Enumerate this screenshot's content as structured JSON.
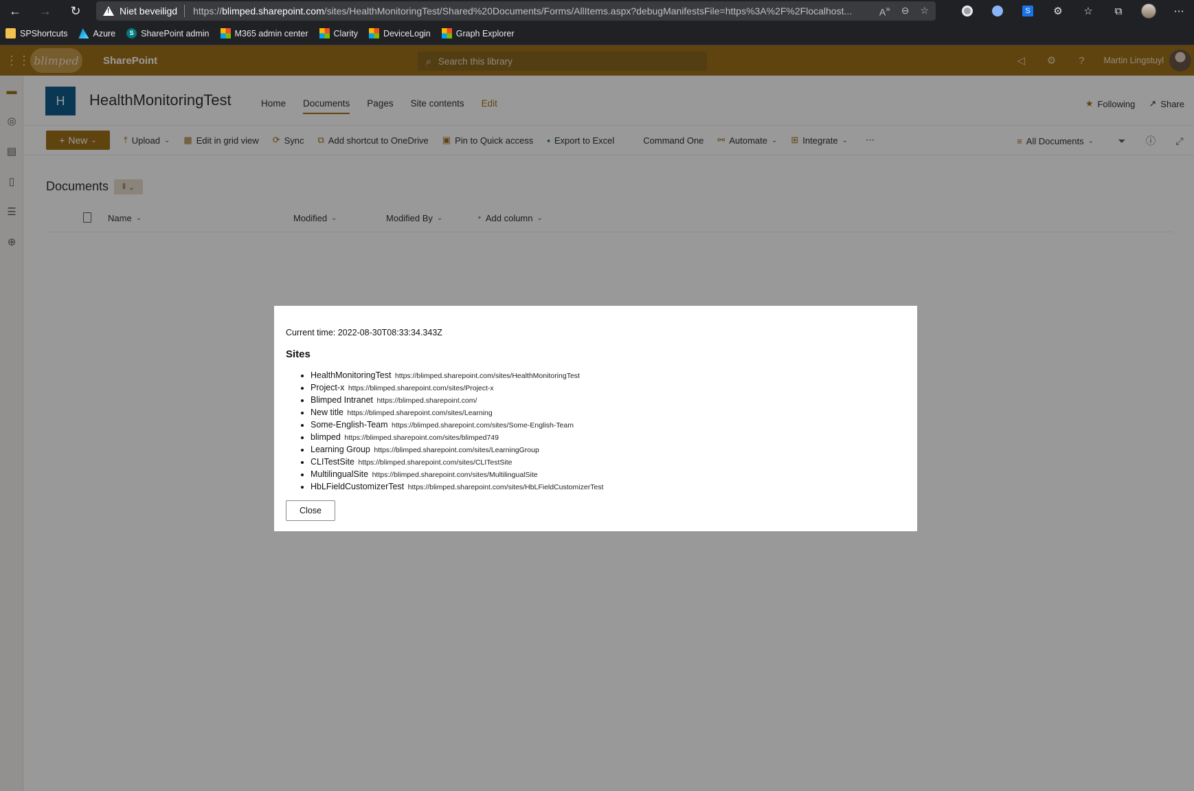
{
  "browser": {
    "security_label": "Niet beveiligd",
    "url_prefix": "https://",
    "url_host": "blimped.sharepoint.com",
    "url_path": "/sites/HealthMonitoringTest/Shared%20Documents/Forms/AllItems.aspx?debugManifestsFile=https%3A%2F%2Flocalhost..."
  },
  "bookmarks": [
    {
      "label": "SPShortcuts",
      "icon": "folder-icon"
    },
    {
      "label": "Azure",
      "icon": "azure-icon"
    },
    {
      "label": "SharePoint admin",
      "icon": "sharepoint-icon"
    },
    {
      "label": "M365 admin center",
      "icon": "microsoft-icon"
    },
    {
      "label": "Clarity",
      "icon": "microsoft-icon"
    },
    {
      "label": "DeviceLogin",
      "icon": "microsoft-icon"
    },
    {
      "label": "Graph Explorer",
      "icon": "microsoft-icon"
    }
  ],
  "suite": {
    "logo_text": "blimped",
    "app_name": "SharePoint",
    "search_placeholder": "Search this library",
    "user_name": "Martin Lingstuyl"
  },
  "site": {
    "logo_letter": "H",
    "title": "HealthMonitoringTest",
    "nav": [
      "Home",
      "Documents",
      "Pages",
      "Site contents",
      "Edit"
    ],
    "following_label": "Following",
    "share_label": "Share"
  },
  "commands": {
    "new_label": "New",
    "upload": "Upload",
    "grid": "Edit in grid view",
    "sync": "Sync",
    "shortcut": "Add shortcut to OneDrive",
    "pin": "Pin to Quick access",
    "export": "Export to Excel",
    "command_one": "Command One",
    "automate": "Automate",
    "integrate": "Integrate",
    "view_name": "All Documents"
  },
  "library": {
    "title": "Documents",
    "columns": {
      "name": "Name",
      "modified": "Modified",
      "modified_by": "Modified By",
      "add_column": "Add column"
    }
  },
  "dialog": {
    "current_time": "Current time: 2022-08-30T08:33:34.343Z",
    "heading": "Sites",
    "sites": [
      {
        "title": "HealthMonitoringTest",
        "url": "https://blimped.sharepoint.com/sites/HealthMonitoringTest"
      },
      {
        "title": "Project-x",
        "url": "https://blimped.sharepoint.com/sites/Project-x"
      },
      {
        "title": "Blimped Intranet",
        "url": "https://blimped.sharepoint.com/"
      },
      {
        "title": "New title",
        "url": "https://blimped.sharepoint.com/sites/Learning"
      },
      {
        "title": "Some-English-Team",
        "url": "https://blimped.sharepoint.com/sites/Some-English-Team"
      },
      {
        "title": "blimped",
        "url": "https://blimped.sharepoint.com/sites/blimped749"
      },
      {
        "title": "Learning Group",
        "url": "https://blimped.sharepoint.com/sites/LearningGroup"
      },
      {
        "title": "CLITestSite",
        "url": "https://blimped.sharepoint.com/sites/CLITestSite"
      },
      {
        "title": "MultilingualSite",
        "url": "https://blimped.sharepoint.com/sites/MultilingualSite"
      },
      {
        "title": "HbLFieldCustomizerTest",
        "url": "https://blimped.sharepoint.com/sites/HbLFieldCustomizerTest"
      }
    ],
    "close_label": "Close"
  },
  "colors": {
    "theme": "#a0721b",
    "site_logo": "#0f5c8c"
  }
}
